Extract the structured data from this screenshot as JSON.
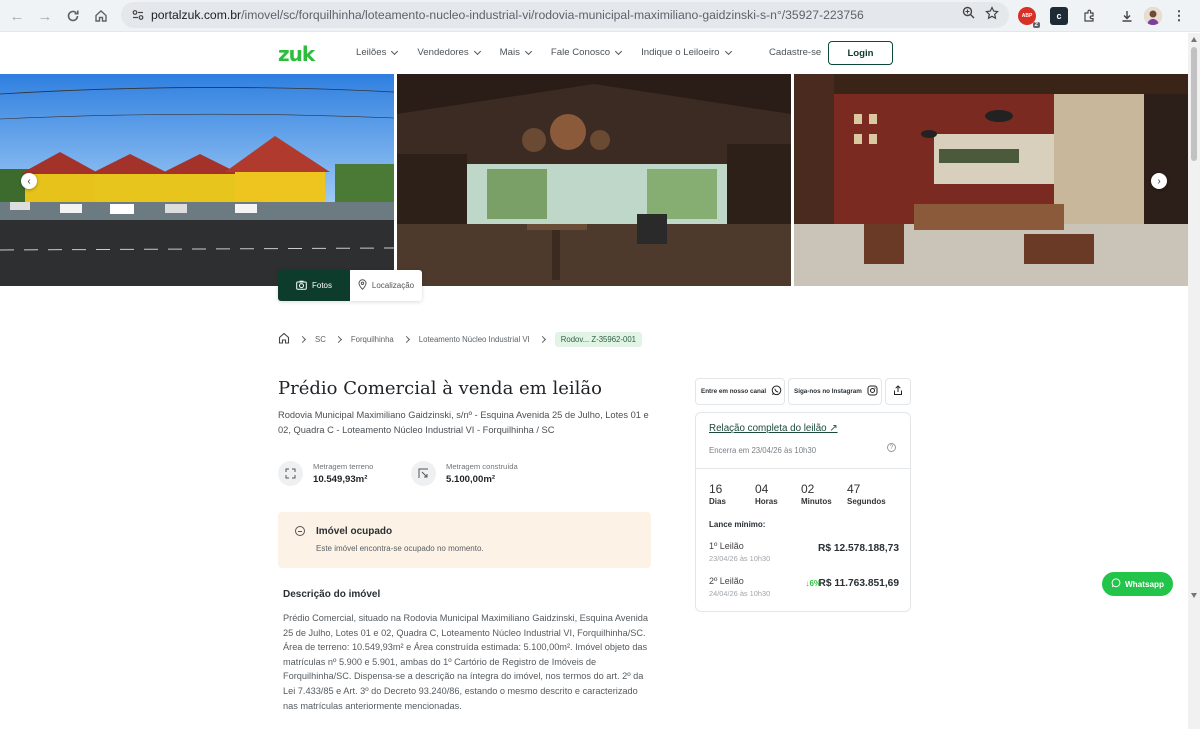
{
  "browser": {
    "url_host": "portalzuk.com.br",
    "url_path": "/imovel/sc/forquilhinha/loteamento-nucleo-industrial-vi/rodovia-municipal-maximiliano-gaidzinski-s-n°/35927-223756",
    "ext_badge": "2",
    "ext_abp_label": "ABP"
  },
  "header": {
    "logo": "zuk",
    "menu": [
      "Leilões",
      "Vendedores",
      "Mais",
      "Fale Conosco",
      "Indique o Leiloeiro"
    ],
    "signup": "Cadastre-se",
    "login": "Login"
  },
  "gallery": {
    "tabs": {
      "photos": "Fotos",
      "location": "Localização"
    }
  },
  "breadcrumb": [
    "SC",
    "Forquilhinha",
    "Loteamento Núcleo Industrial VI",
    "Rodov... Z-35962-001"
  ],
  "property": {
    "title": "Prédio Comercial à venda em leilão",
    "address": "Rodovia Municipal Maximiliano Gaidzinski, s/nº - Esquina Avenida 25 de Julho, Lotes 01 e 02, Quadra C - Loteamento Núcleo Industrial VI - Forquilhinha / SC",
    "land_label": "Metragem terreno",
    "land_value": "10.549,93m²",
    "built_label": "Metragem construída",
    "built_value": "5.100,00m²",
    "occupied_title": "Imóvel ocupado",
    "occupied_text": "Este imóvel encontra-se ocupado no momento.",
    "description_title": "Descrição do imóvel",
    "description": "Prédio Comercial, situado na Rodovia Municipal Maximiliano Gaidzinski, Esquina Avenida 25 de Julho, Lotes 01 e 02, Quadra C, Loteamento Núcleo Industrial VI, Forquilhinha/SC. Área de terreno: 10.549,93m² e Área construída estimada: 5.100,00m². Imóvel objeto das matrículas nº 5.900 e 5.901, ambas do 1º Cartório de Registro de Imóveis de Forquilhinha/SC. Dispensa-se a descrição na íntegra do imóvel, nos termos do art. 2º da Lei 7.433/85 e Art. 3º do Decreto 93.240/86, estando o mesmo descrito e caracterizado nas matrículas anteriormente mencionadas."
  },
  "share": {
    "channel": "Entre em nosso canal",
    "instagram": "Siga-nos no Instagram"
  },
  "auction": {
    "link": "Relação completa do leilão ↗",
    "ends": "Encerra em 23/04/26 às 10h30",
    "help": "?",
    "countdown": [
      {
        "value": "16",
        "label": "Dias"
      },
      {
        "value": "04",
        "label": "Horas"
      },
      {
        "value": "02",
        "label": "Minutos"
      },
      {
        "value": "47",
        "label": "Segundos"
      }
    ],
    "min_bid_label": "Lance mínimo:",
    "rounds": [
      {
        "name": "1º Leilão",
        "date": "23/04/26 às 10h30",
        "price": "R$ 12.578.188,73",
        "discount": ""
      },
      {
        "name": "2º Leilão",
        "date": "24/04/26 às 10h30",
        "price": "R$ 11.763.851,69",
        "discount": "↓6%"
      }
    ]
  },
  "whatsapp": "Whatsapp"
}
